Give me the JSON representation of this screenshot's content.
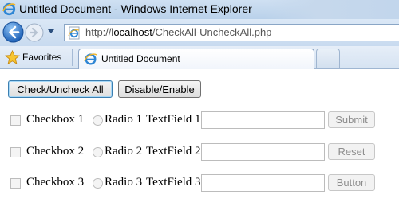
{
  "window": {
    "title": "Untitled Document - Windows Internet Explorer"
  },
  "navigation": {
    "back_icon": "back-arrow-icon",
    "forward_icon": "forward-arrow-icon",
    "address_prefix": "http://",
    "address_host": "localhost",
    "address_path": "/CheckAll-UncheckAll.php"
  },
  "favorites_bar": {
    "favorites_label": "Favorites",
    "active_tab_label": "Untitled Document"
  },
  "page": {
    "check_all_label": "Check/Uncheck All",
    "disable_enable_label": "Disable/Enable",
    "rows": [
      {
        "checkbox_label": "Checkbox 1",
        "radio_label": "Radio 1",
        "text_label": "TextField 1",
        "text_value": "",
        "button_label": "Submit"
      },
      {
        "checkbox_label": "Checkbox 2",
        "radio_label": "Radio 2",
        "text_label": "TextField 2",
        "text_value": "",
        "button_label": "Reset"
      },
      {
        "checkbox_label": "Checkbox 3",
        "radio_label": "Radio 3",
        "text_label": "TextField 3",
        "text_value": "",
        "button_label": "Button"
      }
    ]
  },
  "colors": {
    "chrome_blue": "#c8daef",
    "accent_blue": "#3c7fb1",
    "disabled_text": "#8d8d8d"
  }
}
